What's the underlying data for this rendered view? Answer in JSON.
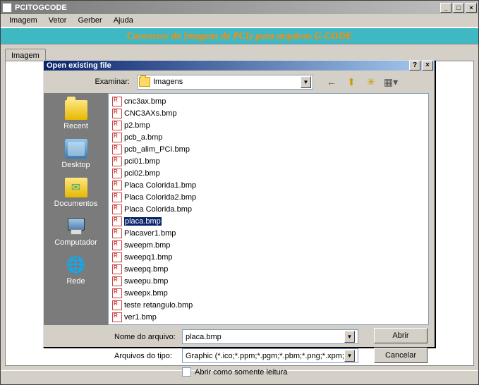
{
  "app": {
    "title": "PCITOGCODE",
    "menu": [
      "Imagem",
      "Vetor",
      "Gerber",
      "Ajuda"
    ],
    "banner": "Conversor de Imagens de PCIs para arquivos G-CODE",
    "tab": "Imagem"
  },
  "dialog": {
    "title": "Open existing file",
    "lookin_label": "Examinar:",
    "lookin_value": "Imagens",
    "places": [
      {
        "label": "Recent",
        "icon": "folder"
      },
      {
        "label": "Desktop",
        "icon": "desktop"
      },
      {
        "label": "Documentos",
        "icon": "docs"
      },
      {
        "label": "Computador",
        "icon": "computer"
      },
      {
        "label": "Rede",
        "icon": "network"
      }
    ],
    "files_col1": [
      "cnc3ax.bmp",
      "CNC3AXs.bmp",
      "p2.bmp",
      "pcb_a.bmp",
      "pcb_alim_PCI.bmp",
      "pci01.bmp",
      "pci02.bmp",
      "Placa Colorida1.bmp",
      "Placa Colorida2.bmp",
      "Placa Colorida.bmp",
      "placa.bmp",
      "Placaver1.bmp",
      "sweepm.bmp",
      "sweepq1.bmp"
    ],
    "files_col2": [
      "sweepq.bmp",
      "sweepu.bmp",
      "sweepx.bmp",
      "teste retangulo.bmp",
      "ver1.bmp"
    ],
    "selected": "placa.bmp",
    "filename_label": "Nome do arquivo:",
    "filename_value": "placa.bmp",
    "filter_label": "Arquivos do tipo:",
    "filter_value": "Graphic (*.ico;*.ppm;*.pgm;*.pbm;*.png;*.xpm;*.bmp",
    "readonly_label": "Abrir como somente leitura",
    "open_btn": "Abrir",
    "cancel_btn": "Cancelar"
  }
}
